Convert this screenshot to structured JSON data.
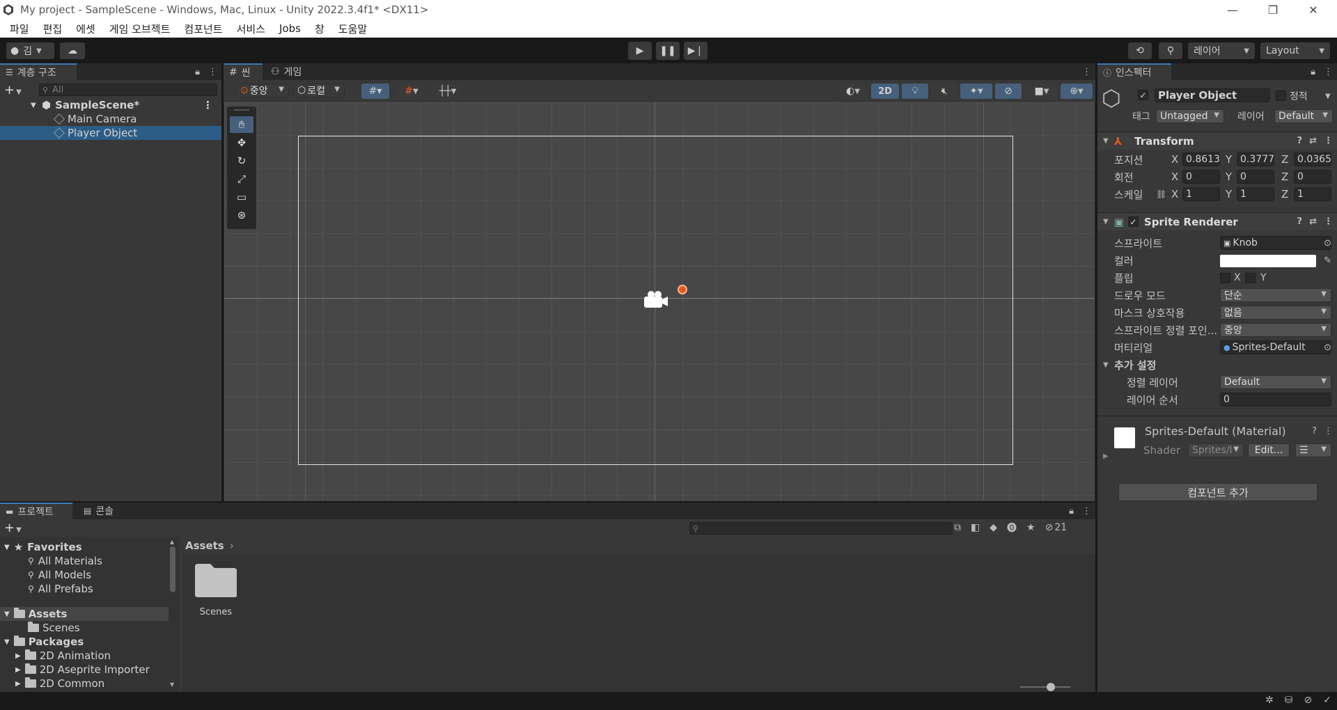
{
  "window": {
    "title": "My project - SampleScene - Windows, Mac, Linux - Unity 2022.3.4f1* <DX11>"
  },
  "menu": [
    "파일",
    "편집",
    "에셋",
    "게임 오브젝트",
    "컴포넌트",
    "서비스",
    "Jobs",
    "창",
    "도움말"
  ],
  "toolbar": {
    "account_label": "김",
    "layers_label": "레이어",
    "layout_label": "Layout"
  },
  "hierarchy": {
    "tab_label": "계층 구조",
    "search_placeholder": "All",
    "scene_name": "SampleScene*",
    "items": [
      "Main Camera",
      "Player Object"
    ],
    "selected": "Player Object"
  },
  "scene": {
    "tab_scene": "씬",
    "tab_game": "게임",
    "pivot_label": "중앙",
    "space_label": "로컬",
    "mode_2d_label": "2D"
  },
  "inspector": {
    "tab_label": "인스펙터",
    "object_name": "Player Object",
    "static_label": "정적",
    "tag_label": "태그",
    "tag_value": "Untagged",
    "layer_label": "레이어",
    "layer_value": "Default",
    "transform": {
      "title": "Transform",
      "position_label": "포지션",
      "rotation_label": "회전",
      "scale_label": "스케일",
      "position": {
        "x": "0.8613",
        "y": "0.3777",
        "z": "0.0365"
      },
      "rotation": {
        "x": "0",
        "y": "0",
        "z": "0"
      },
      "scale": {
        "x": "1",
        "y": "1",
        "z": "1"
      }
    },
    "sprite_renderer": {
      "title": "Sprite Renderer",
      "sprite_label": "스프라이트",
      "sprite_value": "Knob",
      "color_label": "컬러",
      "color_value": "#ffffff",
      "flip_label": "플립",
      "flip_x": "X",
      "flip_y": "Y",
      "draw_mode_label": "드로우 모드",
      "draw_mode_value": "단순",
      "mask_label": "마스크 상호작용",
      "mask_value": "없음",
      "sort_point_label": "스프라이트 정렬 포인...",
      "sort_point_value": "중앙",
      "material_label": "머티리얼",
      "material_value": "Sprites-Default",
      "additional_label": "추가 설정",
      "sorting_layer_label": "정렬 레이어",
      "sorting_layer_value": "Default",
      "order_label": "레이어 순서",
      "order_value": "0"
    },
    "material": {
      "title": "Sprites-Default (Material)",
      "shader_label": "Shader",
      "shader_value": "Sprites/I",
      "edit_label": "Edit..."
    },
    "add_component_label": "컴포넌트 추가"
  },
  "project": {
    "tab_project": "프로젝트",
    "tab_console": "콘솔",
    "hidden_count": "21",
    "breadcrumb": "Assets",
    "favorites_label": "Favorites",
    "favorites": [
      "All Materials",
      "All Models",
      "All Prefabs"
    ],
    "assets_label": "Assets",
    "assets_children": [
      "Scenes"
    ],
    "packages_label": "Packages",
    "packages": [
      "2D Animation",
      "2D Aseprite Importer",
      "2D Common"
    ],
    "grid_items": [
      "Scenes"
    ]
  },
  "colors": {
    "accent_blue": "#2c5d87",
    "gizmo_orange": "#e8591e",
    "panel_bg": "#383838"
  }
}
